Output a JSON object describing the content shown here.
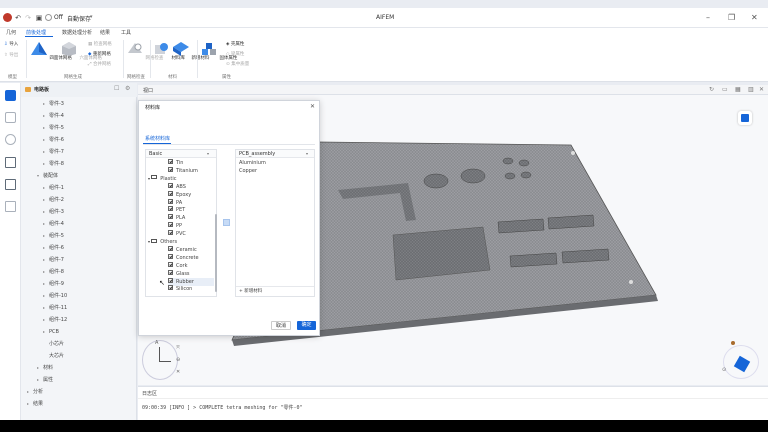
{
  "window": {
    "title": "AIFEM"
  },
  "quick_access": {
    "autosave_label": "Off",
    "doc_name": "自動保存"
  },
  "menu": {
    "tabs": [
      "几何",
      "前後处理",
      "数据处理分析",
      "结果",
      "工具"
    ],
    "active_index": 1
  },
  "ribbon": {
    "import": "导入",
    "export": "导出",
    "group_model": "模型",
    "tetra_mesh": "四面体网格",
    "hexa_mesh": "六面体网格",
    "mesh_info": "检查网格",
    "mesh_refine": "重新网格",
    "mesh_merge": "合并网格",
    "group_mesh_gen": "网格生成",
    "mesh_check": "网格检查",
    "group_mesh_check": "网格检查",
    "material_lib": "材料库",
    "new_material": "新增材料",
    "group_material": "材料",
    "solid_prop": "固体属性",
    "prop_a": "壳属性",
    "prop_b": "梁属性",
    "prop_c": "集中质量",
    "group_property": "属性"
  },
  "tree": {
    "root_label": "电路板",
    "parts": [
      "零件-3",
      "零件-4",
      "零件-5",
      "零件-6",
      "零件-7",
      "零件-8"
    ],
    "board_label": "装配体",
    "components": [
      "组件-1",
      "组件-2",
      "组件-3",
      "组件-4",
      "组件-5",
      "组件-6",
      "组件-7",
      "组件-8",
      "组件-9",
      "组件-10",
      "组件-11",
      "组件-12"
    ],
    "pcb": "PCB",
    "chip_small": "小芯片",
    "chip_large": "大芯片",
    "materials": "材料",
    "properties": "属性",
    "analysis": "分析",
    "results": "结果"
  },
  "viewport": {
    "title": "视口"
  },
  "dialog": {
    "title": "材料库",
    "tab": "系统材料库",
    "library_select": "Basic",
    "categories": [
      {
        "name": "Plastic",
        "items": [
          "ABS",
          "Epoxy",
          "PA",
          "PET",
          "PLA",
          "PP",
          "PVC"
        ]
      },
      {
        "name": "Others",
        "items": [
          "Ceramic",
          "Concrete",
          "Cork",
          "Glass",
          "Rubber",
          "Silicon"
        ]
      }
    ],
    "metal_tail": [
      "Tin",
      "Titanium"
    ],
    "target_select": "PCB_assembly",
    "target_materials": [
      "Aluminium",
      "Copper"
    ],
    "add_material": "+ 新增材料",
    "cancel": "取消",
    "ok": "确定"
  },
  "log": {
    "title": "日志区",
    "line": "09:00:39 [INFO ] > COMPLETE tetra meshing for \"零件-0\""
  },
  "colors": {
    "accent": "#1565d8",
    "mesh": "#8d8f93"
  }
}
